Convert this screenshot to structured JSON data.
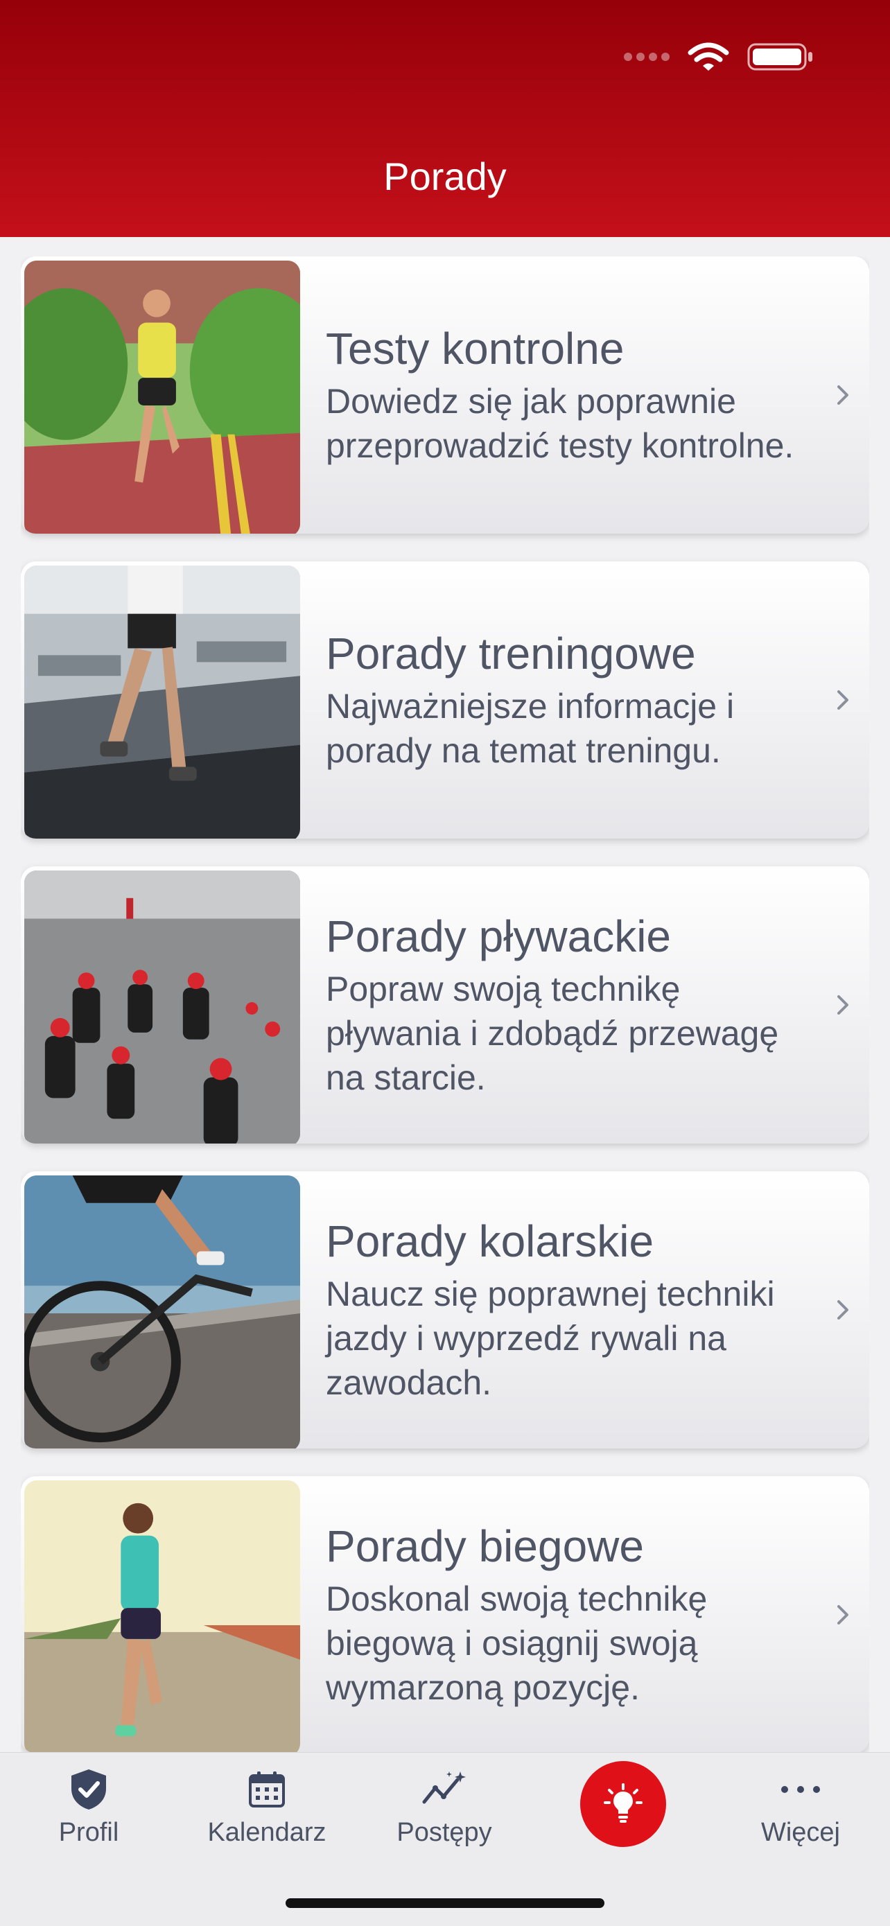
{
  "header": {
    "title": "Porady"
  },
  "cards": [
    {
      "title": "Testy kontrolne",
      "desc": "Dowiedz się jak poprawnie przeprowadzić testy kontrolne.",
      "image": "runner-road-photo"
    },
    {
      "title": "Porady treningowe",
      "desc": "Najważniejsze informacje i porady na temat treningu.",
      "image": "treadmill-photo"
    },
    {
      "title": "Porady pływackie",
      "desc": "Popraw swoją technikę pływania i zdobądź przewagę na starcie.",
      "image": "open-water-swim-photo"
    },
    {
      "title": "Porady kolarskie",
      "desc": "Naucz się poprawnej techniki jazdy i wyprzedź rywali na zawodach.",
      "image": "cyclist-photo"
    },
    {
      "title": "Porady biegowe",
      "desc": "Doskonal swoją technikę biegową i osiągnij swoją wymarzoną pozycję.",
      "image": "woman-runner-photo"
    }
  ],
  "tabs": [
    {
      "label": "Profil",
      "icon": "shield-check-icon"
    },
    {
      "label": "Kalendarz",
      "icon": "calendar-icon"
    },
    {
      "label": "Postępy",
      "icon": "progress-chart-icon"
    },
    {
      "label": "",
      "icon": "lightbulb-icon",
      "active": true
    },
    {
      "label": "Więcej",
      "icon": "more-dots-icon"
    }
  ],
  "colors": {
    "brand_red": "#c4101a",
    "active_tab": "#e01019",
    "text": "#4f5565"
  }
}
